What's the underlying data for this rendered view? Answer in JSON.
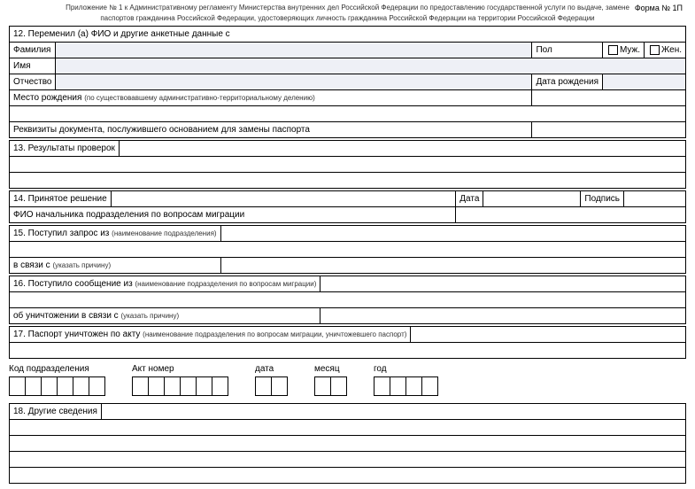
{
  "header": {
    "line1": "Приложение № 1 к Административному регламенту Министерства внутренних дел Российской Федерации по предоставлению государственной услуги по выдаче, замене",
    "line2": "паспортов гражданина Российской Федерации, удостоверяющих личность гражданина Российской Федерации на территории Российской Федерации",
    "form_no": "Форма № 1П"
  },
  "s12": {
    "title": "12. Переменил (а) ФИО и другие анкетные данные с",
    "lastname": "Фамилия",
    "sex": "Пол",
    "male": "Муж.",
    "female": "Жен.",
    "firstname": "Имя",
    "patronymic": "Отчество",
    "dob": "Дата рождения",
    "birthplace": "Место рождения",
    "birthplace_sub": "(по существовавшему административно-территориальному делению)",
    "doc_basis": "Реквизиты документа, послужившего основанием для замены паспорта"
  },
  "s13": {
    "title": "13. Результаты проверок"
  },
  "s14": {
    "title": "14. Принятое решение",
    "date": "Дата",
    "sign": "Подпись",
    "head": "ФИО начальника подразделения по вопросам миграции"
  },
  "s15": {
    "title": "15. Поступил запрос из",
    "title_sub": "(наименование подразделения)",
    "reason": "в связи с",
    "reason_sub": "(указать причину)"
  },
  "s16": {
    "title": "16. Поступило сообщение из",
    "title_sub": "(наименование подразделения по вопросам миграции)",
    "destroy": "об уничтожении в связи с",
    "destroy_sub": "(указать причину)"
  },
  "s17": {
    "title": "17. Паспорт уничтожен по акту",
    "title_sub": "(наименование подразделения по вопросам миграции, уничтожевшего паспорт)",
    "code": "Код подразделения",
    "act": "Акт номер",
    "date": "дата",
    "month": "месяц",
    "year": "год"
  },
  "s18": {
    "title": "18. Другие сведения"
  }
}
